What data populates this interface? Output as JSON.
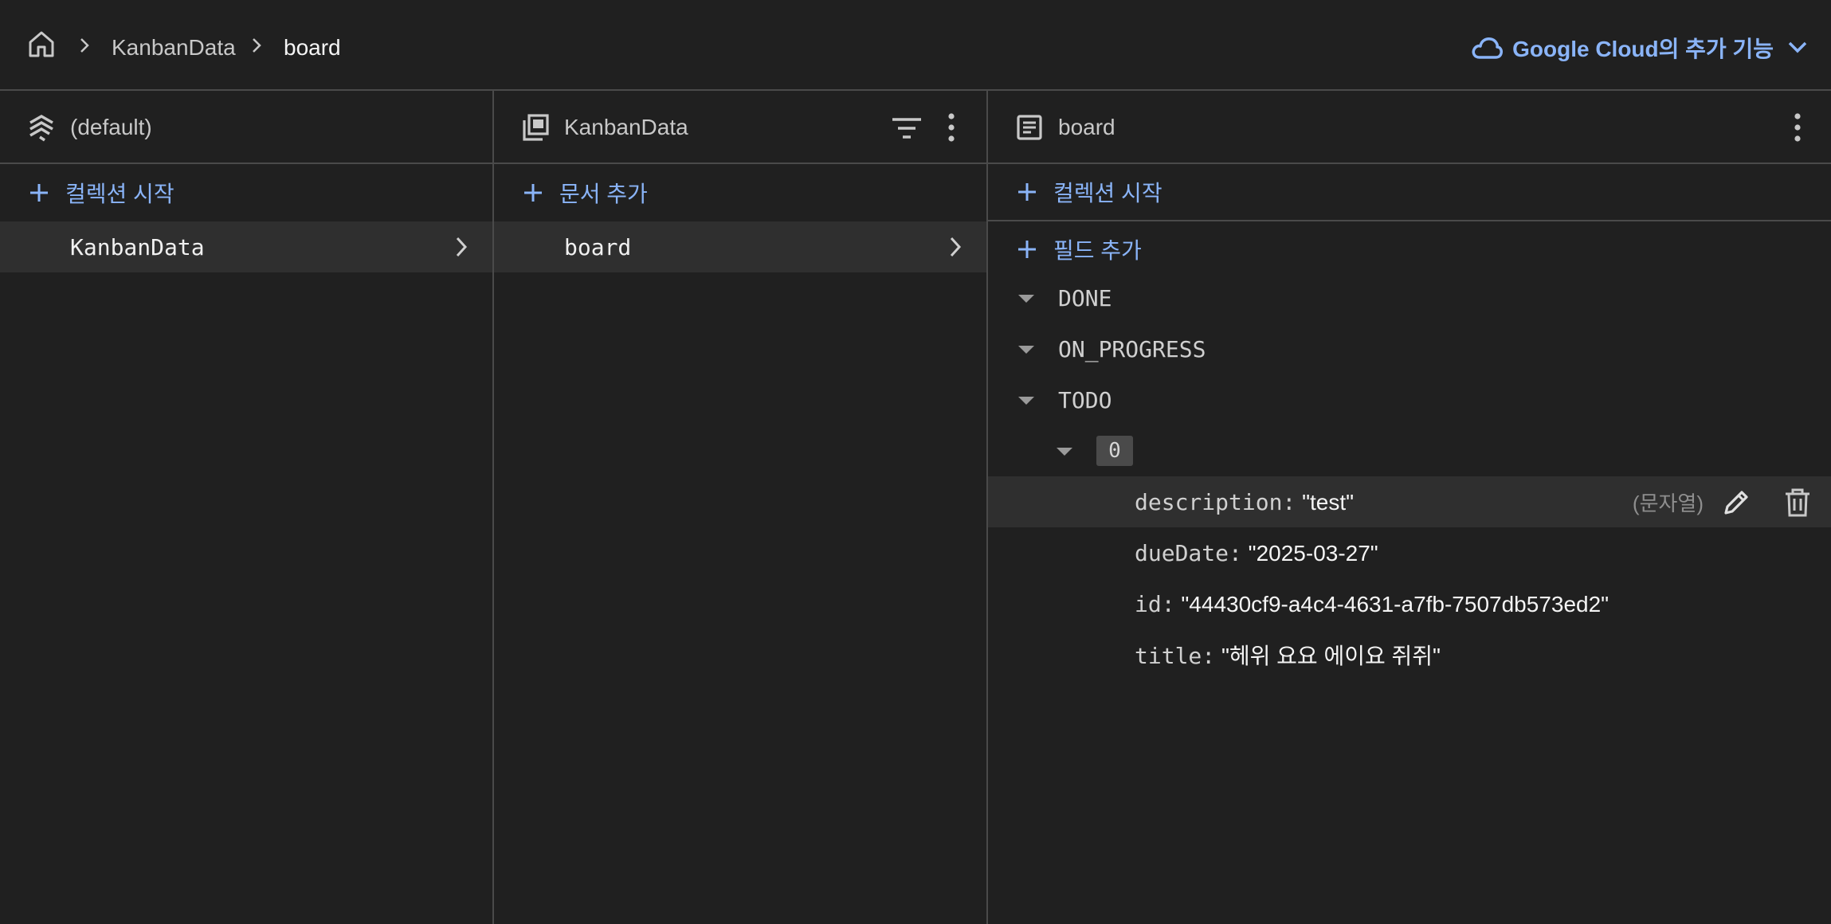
{
  "breadcrumb": {
    "items": [
      "KanbanData",
      "board"
    ]
  },
  "header": {
    "google_cloud_label": "Google Cloud의 추가 기능"
  },
  "panels": {
    "root": {
      "title": "(default)",
      "action": "컬렉션 시작",
      "items": [
        "KanbanData"
      ]
    },
    "collection": {
      "title": "KanbanData",
      "action": "문서 추가",
      "items": [
        "board"
      ]
    },
    "document": {
      "title": "board",
      "action_collection": "컬렉션 시작",
      "action_field": "필드 추가",
      "fields": {
        "done": "DONE",
        "on_progress": "ON_PROGRESS",
        "todo": "TODO",
        "todo_index": "0",
        "description_key": "description:",
        "description_val": "\"test\"",
        "description_type": "(문자열)",
        "duedate_key": "dueDate:",
        "duedate_val": "\"2025-03-27\"",
        "id_key": "id:",
        "id_val": "\"44430cf9-a4c4-4631-a7fb-7507db573ed2\"",
        "title_key": "title:",
        "title_val": "\"헤위 요요 에이요 쥐쥐\""
      }
    }
  },
  "colors": {
    "accent": "#8ab4f8",
    "background": "#202020",
    "border": "#4a4a4a",
    "selected_row": "#2f2f2f"
  }
}
